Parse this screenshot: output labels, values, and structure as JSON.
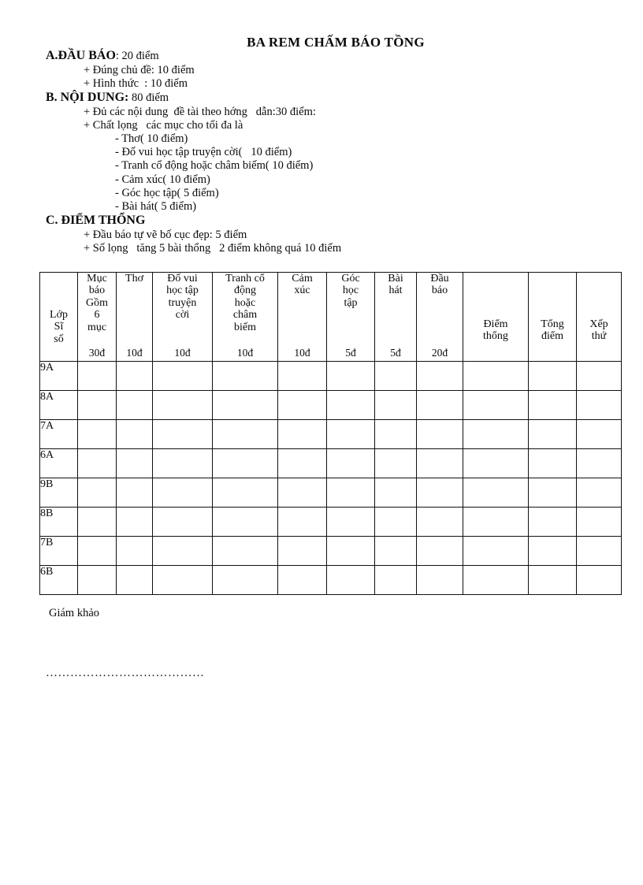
{
  "document": {
    "title": "BA REM CHẤM BÁO TỒNG"
  },
  "criteria": [
    {
      "level": 0,
      "head": "A.ĐẦU BÁO",
      "value": ": 20 điểm"
    },
    {
      "level": 1,
      "head": "",
      "value": "+ Đúng chủ đề: 10 điểm"
    },
    {
      "level": 1,
      "head": "",
      "value": "+ Hình thức  : 10 điểm"
    },
    {
      "level": 0,
      "head": "B. NỘI DUNG:",
      "value": " 80 điểm"
    },
    {
      "level": 1,
      "head": "",
      "value": "+ Đủ các nội dung  đề tài theo hớng   dẫn:30 điểm:"
    },
    {
      "level": 1,
      "head": "",
      "value": "+ Chất lọng   các mục cho tối đa là"
    },
    {
      "level": 2,
      "head": "",
      "value": "- Thơ( 10 điểm)"
    },
    {
      "level": 2,
      "head": "",
      "value": "- Đố vui học tập truyện cời(   10 điểm)"
    },
    {
      "level": 2,
      "head": "",
      "value": "- Tranh cổ động hoặc châm biếm( 10 điểm)"
    },
    {
      "level": 2,
      "head": "",
      "value": "- Cảm xúc( 10 điểm)"
    },
    {
      "level": 2,
      "head": "",
      "value": "- Góc học tập( 5 điểm)"
    },
    {
      "level": 2,
      "head": "",
      "value": "- Bài hát( 5 điểm)"
    },
    {
      "level": 0,
      "head": "C. ĐIỂM THỔNG",
      "value": ""
    },
    {
      "level": 1,
      "head": "",
      "value": "+ Đầu báo tự vẽ bố cục đẹp: 5 điểm"
    },
    {
      "level": 1,
      "head": "",
      "value": "+ Số lọng   tăng 5 bài thổng   2 điểm không quá 10 điểm"
    }
  ],
  "table": {
    "columns": [
      {
        "label": "Lớp\nSĩ\nsố",
        "points": "",
        "style": "class"
      },
      {
        "label": "Mục\nbáo\nGồm\n6\nmục",
        "points": "30đ",
        "style": "top"
      },
      {
        "label": "Thơ",
        "points": "10đ",
        "style": "top"
      },
      {
        "label": "Đố vui\nhọc tập\ntruyện\ncời",
        "points": "10đ",
        "style": "top"
      },
      {
        "label": "Tranh cổ\nđộng\nhoặc\nchâm\nbiếm",
        "points": "10đ",
        "style": "top"
      },
      {
        "label": "Cảm\nxúc",
        "points": "10đ",
        "style": "top"
      },
      {
        "label": "Góc\nhọc\ntập",
        "points": "5đ",
        "style": "top"
      },
      {
        "label": "Bài\nhát",
        "points": "5đ",
        "style": "top"
      },
      {
        "label": "Đầu\nbáo",
        "points": "20đ",
        "style": "top"
      },
      {
        "label": "Điểm\nthổng",
        "points": "",
        "style": "mid"
      },
      {
        "label": "Tổng\nđiểm",
        "points": "",
        "style": "mid"
      },
      {
        "label": "Xếp\nthứ",
        "points": "",
        "style": "mid"
      }
    ],
    "rows": [
      {
        "class": "9A",
        "cells": [
          "",
          "",
          "",
          "",
          "",
          "",
          "",
          "",
          "",
          "",
          ""
        ]
      },
      {
        "class": "8A",
        "cells": [
          "",
          "",
          "",
          "",
          "",
          "",
          "",
          "",
          "",
          "",
          ""
        ]
      },
      {
        "class": "7A",
        "cells": [
          "",
          "",
          "",
          "",
          "",
          "",
          "",
          "",
          "",
          "",
          ""
        ]
      },
      {
        "class": "6A",
        "cells": [
          "",
          "",
          "",
          "",
          "",
          "",
          "",
          "",
          "",
          "",
          ""
        ]
      },
      {
        "class": "9B",
        "cells": [
          "",
          "",
          "",
          "",
          "",
          "",
          "",
          "",
          "",
          "",
          ""
        ]
      },
      {
        "class": "8B",
        "cells": [
          "",
          "",
          "",
          "",
          "",
          "",
          "",
          "",
          "",
          "",
          ""
        ]
      },
      {
        "class": "7B",
        "cells": [
          "",
          "",
          "",
          "",
          "",
          "",
          "",
          "",
          "",
          "",
          ""
        ]
      },
      {
        "class": "6B",
        "cells": [
          "",
          "",
          "",
          "",
          "",
          "",
          "",
          "",
          "",
          "",
          ""
        ]
      }
    ]
  },
  "footer": {
    "examiner_label": "Giám khảo",
    "signature_dots": "…………………………………"
  }
}
